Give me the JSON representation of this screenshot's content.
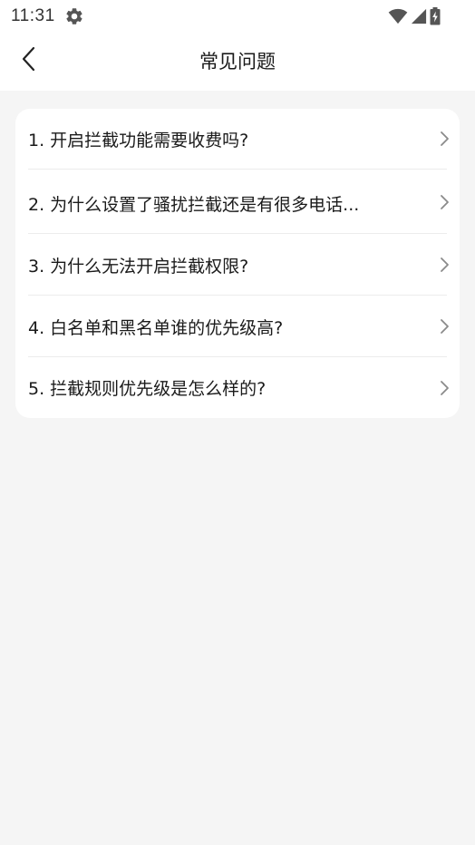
{
  "status_bar": {
    "time": "11:31",
    "settings_icon": "gear-icon",
    "wifi_icon": "wifi-icon",
    "signal_icon": "cellular-signal-icon",
    "battery_icon": "battery-charging-icon"
  },
  "header": {
    "title": "常见问题",
    "back_icon": "chevron-left-icon"
  },
  "faq": {
    "items": [
      {
        "label": "1. 开启拦截功能需要收费吗?"
      },
      {
        "label": "2. 为什么设置了骚扰拦截还是有很多电话..."
      },
      {
        "label": "3. 为什么无法开启拦截权限?"
      },
      {
        "label": "4. 白名单和黑名单谁的优先级高?"
      },
      {
        "label": "5. 拦截规则优先级是怎么样的?"
      }
    ]
  },
  "colors": {
    "page_background": "#f5f5f5",
    "card_background": "#ffffff",
    "text_primary": "#1a1a1a",
    "chevron": "#8a8a8a",
    "divider": "#ececec"
  }
}
